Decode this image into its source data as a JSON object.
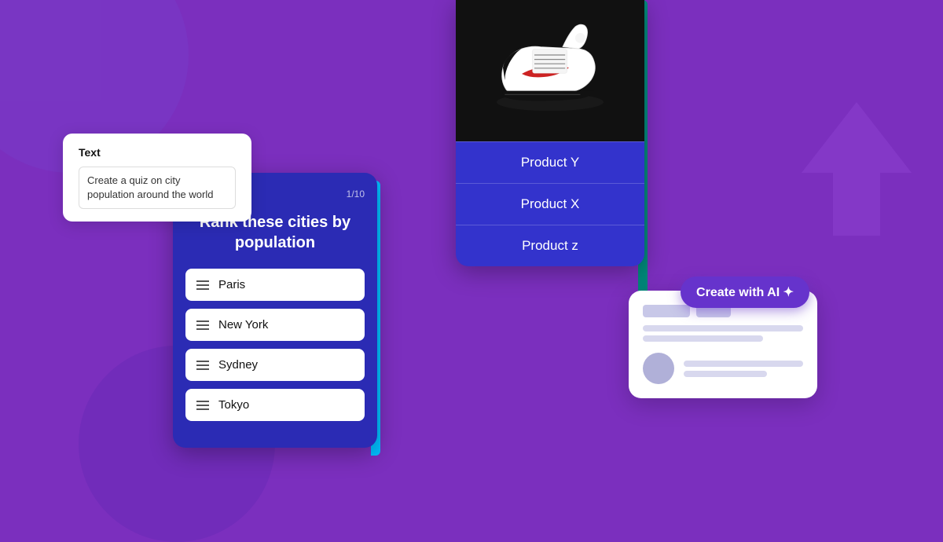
{
  "background": {
    "color": "#7B2FBE"
  },
  "text_prompt_card": {
    "label": "Text",
    "content": "Create a quiz on city population around the world"
  },
  "quiz_card": {
    "counter": "1/10",
    "title": "Rank these cities by population",
    "items": [
      {
        "label": "Paris"
      },
      {
        "label": "New York"
      },
      {
        "label": "Sydney"
      },
      {
        "label": "Tokyo"
      }
    ]
  },
  "product_card": {
    "options": [
      {
        "label": "Product Y"
      },
      {
        "label": "Product X"
      },
      {
        "label": "Product z"
      }
    ]
  },
  "ai_card": {
    "button_label": "Create with AI ✦"
  }
}
